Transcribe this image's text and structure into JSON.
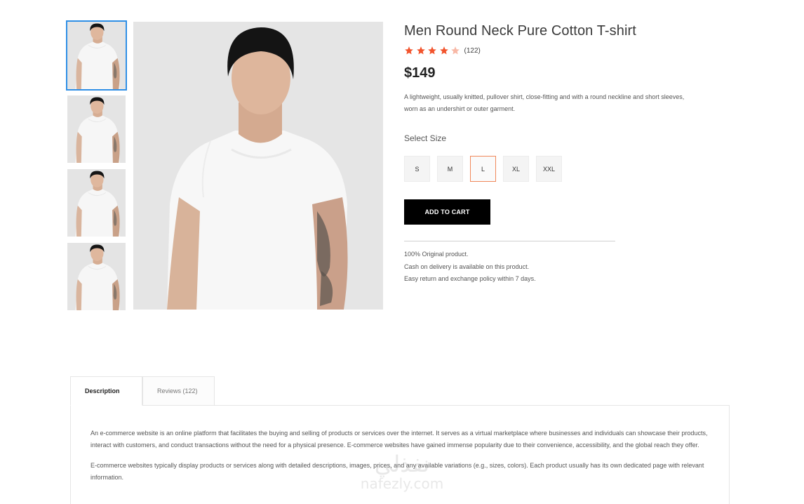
{
  "product": {
    "title": "Men Round Neck Pure Cotton T-shirt",
    "rating": 4,
    "rating_max": 5,
    "rating_count": "(122)",
    "price": "$149",
    "description": "A lightweight, usually knitted, pullover shirt, close-fitting and with a round neckline and short sleeves, worn as an undershirt or outer garment."
  },
  "gallery": {
    "thumbnail_count": 4,
    "active_index": 0
  },
  "size_selector": {
    "label": "Select Size",
    "options": [
      "S",
      "M",
      "L",
      "XL",
      "XXL"
    ],
    "selected": "L"
  },
  "cart": {
    "button_label": "ADD TO CART"
  },
  "policies": [
    "100% Original product.",
    "Cash on delivery is available on this product.",
    "Easy return and exchange policy within 7 days."
  ],
  "tabs": [
    {
      "label": "Description",
      "active": true
    },
    {
      "label": "Reviews (122)",
      "active": false
    }
  ],
  "description_tab": {
    "paragraphs": [
      "An e-commerce website is an online platform that facilitates the buying and selling of products or services over the internet. It serves as a virtual marketplace where businesses and individuals can showcase their products, interact with customers, and conduct transactions without the need for a physical presence. E-commerce websites have gained immense popularity due to their convenience, accessibility, and the global reach they offer.",
      "E-commerce websites typically display products or services along with detailed descriptions, images, prices, and any available variations (e.g., sizes, colors). Each product usually has its own dedicated page with relevant information."
    ]
  },
  "watermark": {
    "arabic": "نفذلي",
    "latin": "nafezly.com"
  },
  "colors": {
    "star": "#f2542d",
    "star_empty": "#f8b8a6",
    "accent_selected": "#f0885a",
    "thumb_active": "#2f8fe6",
    "cart_bg": "#000000"
  }
}
